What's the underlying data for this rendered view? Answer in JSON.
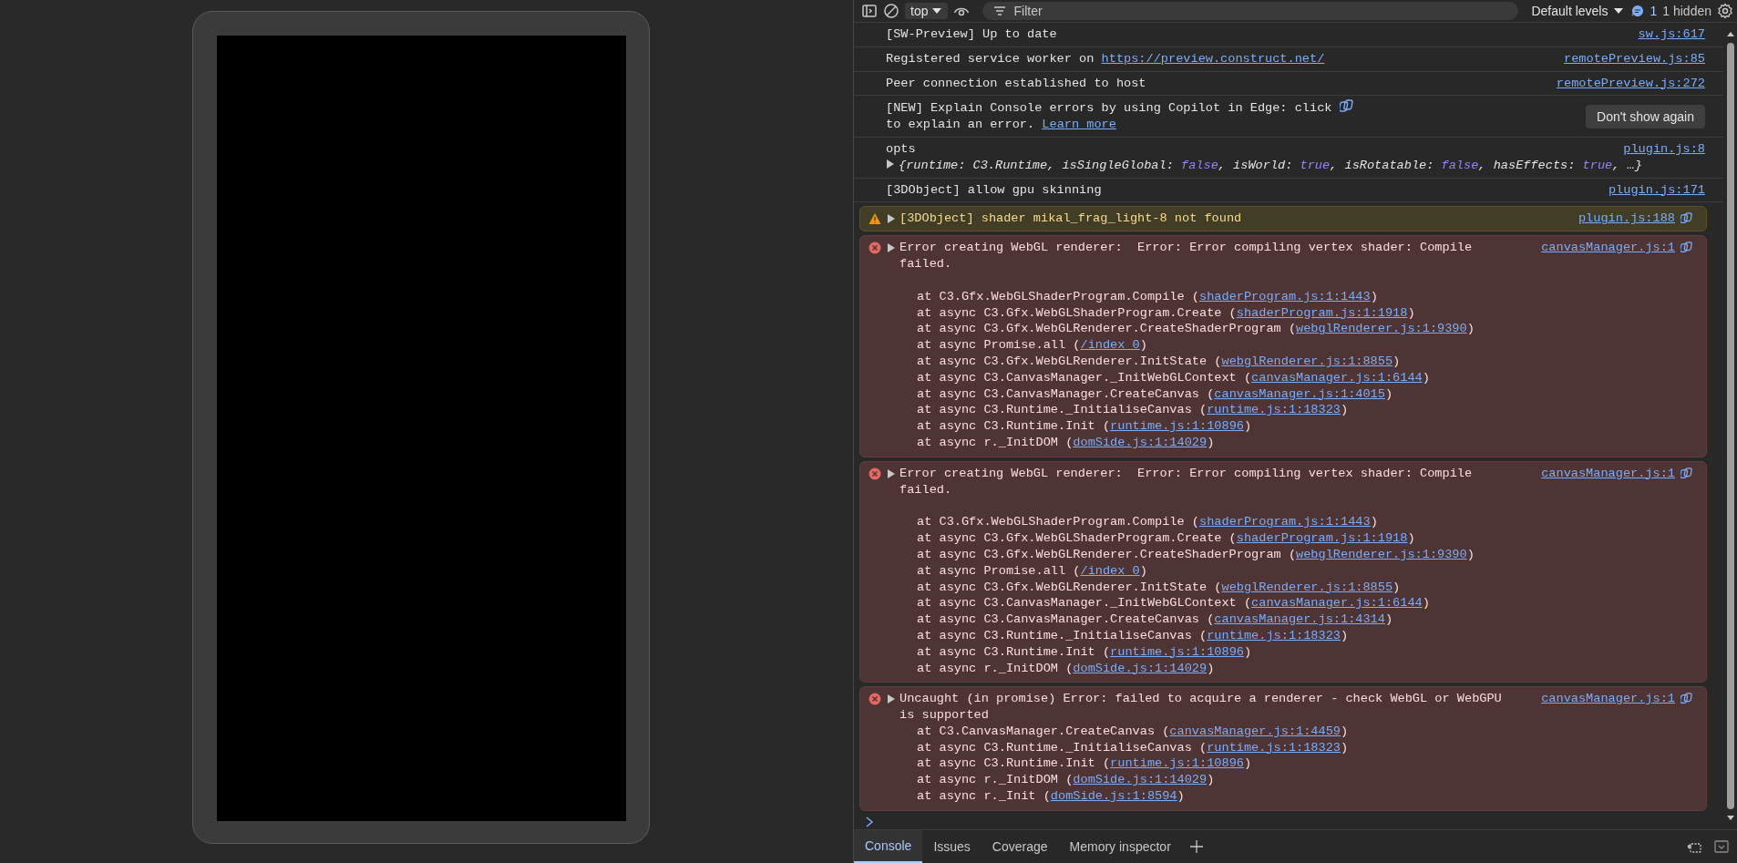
{
  "toolbar": {
    "context": "top",
    "filter_placeholder": "Filter",
    "levels": "Default levels",
    "issues_count": "1",
    "hidden": "1 hidden"
  },
  "messages": [
    {
      "kind": "log",
      "text": "[SW-Preview] Up to date",
      "source": "sw.js:617"
    },
    {
      "kind": "log",
      "text": "Registered service worker on ",
      "link": "https://preview.construct.net/",
      "source": "remotePreview.js:85"
    },
    {
      "kind": "log",
      "text": "Peer connection established to host",
      "source": "remotePreview.js:272"
    },
    {
      "kind": "promo",
      "text": "[NEW] Explain Console errors by using Copilot in Edge: click",
      "text_after": " to explain an error. ",
      "link": "Learn more",
      "button": "Don't show again"
    },
    {
      "kind": "object",
      "text": "opts",
      "source": "plugin.js:8",
      "expanded": false,
      "preview": [
        {
          "text": "{runtime: C3.Runtime, isSingleGlobal: ",
          "kind": "plain"
        },
        {
          "text": "false",
          "kind": "boolean"
        },
        {
          "text": ", isWorld: ",
          "kind": "plain"
        },
        {
          "text": "true",
          "kind": "boolean"
        },
        {
          "text": ", isRotatable: ",
          "kind": "plain"
        },
        {
          "text": "false",
          "kind": "boolean"
        },
        {
          "text": ", hasEffects: ",
          "kind": "plain"
        },
        {
          "text": "true",
          "kind": "boolean"
        },
        {
          "text": ", …}",
          "kind": "plain"
        }
      ]
    },
    {
      "kind": "log",
      "text": "[3DObject] allow gpu skinning",
      "source": "plugin.js:171"
    },
    {
      "kind": "warning",
      "expanded": false,
      "text": "[3DObject] shader mikal_frag_light-8 not found",
      "source": "plugin.js:188",
      "explain": true
    },
    {
      "kind": "error",
      "expanded": false,
      "text": "Error creating WebGL renderer:  Error: Error compiling vertex shader: Compile failed.",
      "source": "canvasManager.js:1",
      "explain": true,
      "gap": true,
      "stack": [
        {
          "call": "at C3.Gfx.WebGLShaderProgram.Compile (",
          "link": "shaderProgram.js:1:1443",
          "after": ")"
        },
        {
          "call": "at async C3.Gfx.WebGLShaderProgram.Create (",
          "link": "shaderProgram.js:1:1918",
          "after": ")"
        },
        {
          "call": "at async C3.Gfx.WebGLRenderer.CreateShaderProgram (",
          "link": "webglRenderer.js:1:9390",
          "after": ")"
        },
        {
          "call": "at async Promise.all (",
          "link": "/index 0",
          "after": ")"
        },
        {
          "call": "at async C3.Gfx.WebGLRenderer.InitState (",
          "link": "webglRenderer.js:1:8855",
          "after": ")"
        },
        {
          "call": "at async C3.CanvasManager._InitWebGLContext (",
          "link": "canvasManager.js:1:6144",
          "after": ")"
        },
        {
          "call": "at async C3.CanvasManager.CreateCanvas (",
          "link": "canvasManager.js:1:4015",
          "after": ")"
        },
        {
          "call": "at async C3.Runtime._InitialiseCanvas (",
          "link": "runtime.js:1:18323",
          "after": ")"
        },
        {
          "call": "at async C3.Runtime.Init (",
          "link": "runtime.js:1:10896",
          "after": ")"
        },
        {
          "call": "at async r._InitDOM (",
          "link": "domSide.js:1:14029",
          "after": ")"
        }
      ]
    },
    {
      "kind": "error",
      "expanded": false,
      "text": "Error creating WebGL renderer:  Error: Error compiling vertex shader: Compile failed.",
      "source": "canvasManager.js:1",
      "explain": true,
      "gap": true,
      "stack": [
        {
          "call": "at C3.Gfx.WebGLShaderProgram.Compile (",
          "link": "shaderProgram.js:1:1443",
          "after": ")"
        },
        {
          "call": "at async C3.Gfx.WebGLShaderProgram.Create (",
          "link": "shaderProgram.js:1:1918",
          "after": ")"
        },
        {
          "call": "at async C3.Gfx.WebGLRenderer.CreateShaderProgram (",
          "link": "webglRenderer.js:1:9390",
          "after": ")"
        },
        {
          "call": "at async Promise.all (",
          "link": "/index 0",
          "after": ")"
        },
        {
          "call": "at async C3.Gfx.WebGLRenderer.InitState (",
          "link": "webglRenderer.js:1:8855",
          "after": ")"
        },
        {
          "call": "at async C3.CanvasManager._InitWebGLContext (",
          "link": "canvasManager.js:1:6144",
          "after": ")"
        },
        {
          "call": "at async C3.CanvasManager.CreateCanvas (",
          "link": "canvasManager.js:1:4314",
          "after": ")"
        },
        {
          "call": "at async C3.Runtime._InitialiseCanvas (",
          "link": "runtime.js:1:18323",
          "after": ")"
        },
        {
          "call": "at async C3.Runtime.Init (",
          "link": "runtime.js:1:10896",
          "after": ")"
        },
        {
          "call": "at async r._InitDOM (",
          "link": "domSide.js:1:14029",
          "after": ")"
        }
      ]
    },
    {
      "kind": "error",
      "expanded": false,
      "text": "Uncaught (in promise) Error: failed to acquire a renderer - check WebGL or WebGPU is supported",
      "source": "canvasManager.js:1",
      "explain": true,
      "gap": false,
      "stack": [
        {
          "call": "at C3.CanvasManager.CreateCanvas (",
          "link": "canvasManager.js:1:4459",
          "after": ")"
        },
        {
          "call": "at async C3.Runtime._InitialiseCanvas (",
          "link": "runtime.js:1:18323",
          "after": ")"
        },
        {
          "call": "at async C3.Runtime.Init (",
          "link": "runtime.js:1:10896",
          "after": ")"
        },
        {
          "call": "at async r._InitDOM (",
          "link": "domSide.js:1:14029",
          "after": ")"
        },
        {
          "call": "at async r._Init (",
          "link": "domSide.js:1:8594",
          "after": ")"
        }
      ]
    }
  ],
  "drawer_tabs": [
    {
      "label": "Console",
      "selected": true
    },
    {
      "label": "Issues",
      "selected": false
    },
    {
      "label": "Coverage",
      "selected": false
    },
    {
      "label": "Memory inspector",
      "selected": false
    }
  ]
}
